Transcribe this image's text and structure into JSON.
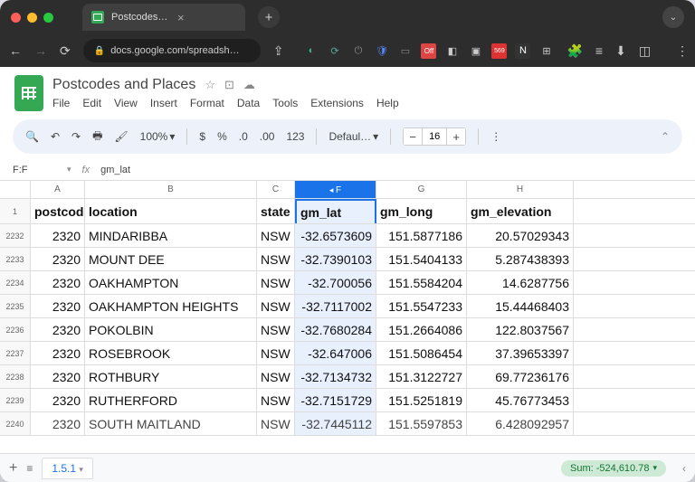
{
  "browser": {
    "tab_title": "Postcodes and Places - Googl…",
    "url": "docs.google.com/spreadsh…"
  },
  "doc": {
    "title": "Postcodes and Places",
    "menus": [
      "File",
      "Edit",
      "View",
      "Insert",
      "Format",
      "Data",
      "Tools",
      "Extensions",
      "Help"
    ]
  },
  "toolbar": {
    "zoom": "100%",
    "font": "Defaul…",
    "fontsize": "16"
  },
  "fx": {
    "namebox": "F:F",
    "formula": "gm_lat"
  },
  "columns": {
    "widths": [
      60,
      190,
      42,
      90,
      100,
      118
    ],
    "labels": [
      "A",
      "B",
      "C",
      "F",
      "G",
      "H"
    ]
  },
  "header_row": {
    "rownum": "1",
    "cells": [
      "postcode",
      "location",
      "state",
      "gm_lat",
      "gm_long",
      "gm_elevation"
    ]
  },
  "data_rows": [
    {
      "rownum": "2232",
      "cells": [
        "2320",
        "MINDARIBBA",
        "NSW",
        "-32.6573609",
        "151.5877186",
        "20.57029343"
      ]
    },
    {
      "rownum": "2233",
      "cells": [
        "2320",
        "MOUNT DEE",
        "NSW",
        "-32.7390103",
        "151.5404133",
        "5.287438393"
      ]
    },
    {
      "rownum": "2234",
      "cells": [
        "2320",
        "OAKHAMPTON",
        "NSW",
        "-32.700056",
        "151.5584204",
        "14.6287756"
      ]
    },
    {
      "rownum": "2235",
      "cells": [
        "2320",
        "OAKHAMPTON HEIGHTS",
        "NSW",
        "-32.7117002",
        "151.5547233",
        "15.44468403"
      ]
    },
    {
      "rownum": "2236",
      "cells": [
        "2320",
        "POKOLBIN",
        "NSW",
        "-32.7680284",
        "151.2664086",
        "122.8037567"
      ]
    },
    {
      "rownum": "2237",
      "cells": [
        "2320",
        "ROSEBROOK",
        "NSW",
        "-32.647006",
        "151.5086454",
        "37.39653397"
      ]
    },
    {
      "rownum": "2238",
      "cells": [
        "2320",
        "ROTHBURY",
        "NSW",
        "-32.7134732",
        "151.3122727",
        "69.77236176"
      ]
    },
    {
      "rownum": "2239",
      "cells": [
        "2320",
        "RUTHERFORD",
        "NSW",
        "-32.7151729",
        "151.5251819",
        "45.76773453"
      ]
    },
    {
      "rownum": "2240",
      "cells": [
        "2320",
        "SOUTH MAITLAND",
        "NSW",
        "-32.7445112",
        "151.5597853",
        "6.428092957"
      ]
    }
  ],
  "bottom": {
    "sheet_tab": "1.5.1",
    "sum": "Sum: -524,610.78"
  }
}
